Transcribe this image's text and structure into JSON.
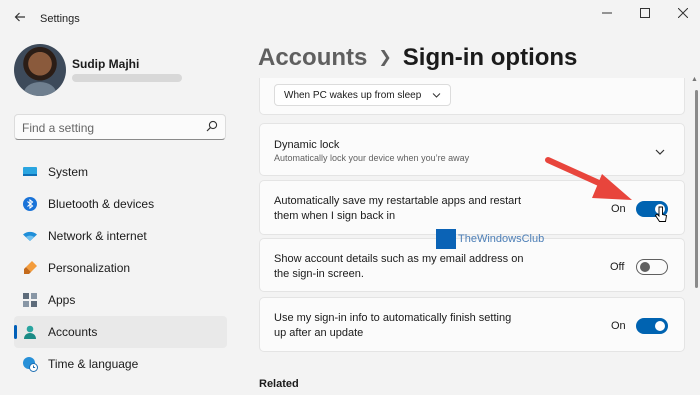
{
  "window": {
    "title": "Settings",
    "controls": [
      "minimize-icon",
      "maximize-icon",
      "close-icon"
    ]
  },
  "profile": {
    "name": "Sudip Majhi"
  },
  "search": {
    "placeholder": "Find a setting"
  },
  "nav": {
    "items": [
      {
        "label": "System",
        "icon": "system-icon",
        "active": false
      },
      {
        "label": "Bluetooth & devices",
        "icon": "bluetooth-icon",
        "active": false
      },
      {
        "label": "Network & internet",
        "icon": "wifi-icon",
        "active": false
      },
      {
        "label": "Personalization",
        "icon": "brush-icon",
        "active": false
      },
      {
        "label": "Apps",
        "icon": "apps-icon",
        "active": false
      },
      {
        "label": "Accounts",
        "icon": "person-icon",
        "active": true
      },
      {
        "label": "Time & language",
        "icon": "globe-clock-icon",
        "active": false
      }
    ]
  },
  "header": {
    "parent": "Accounts",
    "current": "Sign-in options"
  },
  "settings": {
    "wake_dropdown": "When PC wakes up from sleep",
    "dynamic_lock": {
      "title": "Dynamic lock",
      "description": "Automatically lock your device when you’re away"
    },
    "restart_apps": {
      "title_line1": "Automatically save my restartable apps and restart",
      "title_line2": "them when I sign back in",
      "state": "On",
      "enabled": true
    },
    "account_details": {
      "title_line1": "Show account details such as my email address on",
      "title_line2": "the sign-in screen.",
      "state": "Off",
      "enabled": false
    },
    "finish_setup": {
      "title_line1": "Use my sign-in info to automatically finish setting",
      "title_line2": "up after an update",
      "state": "On",
      "enabled": true
    }
  },
  "related": {
    "title": "Related"
  },
  "watermark": {
    "text": "TheWindowsClub"
  },
  "colors": {
    "accent": "#005fb8",
    "toggle_on": "#0063b1",
    "annotation_arrow": "#e8453c"
  }
}
